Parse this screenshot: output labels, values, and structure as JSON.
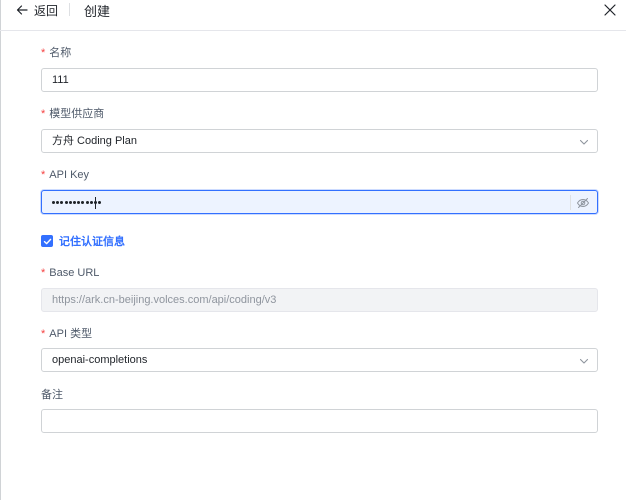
{
  "header": {
    "back_label": "返回",
    "title": "创建"
  },
  "form": {
    "name": {
      "label": "名称",
      "required": "*",
      "value": "111"
    },
    "provider": {
      "label": "模型供应商",
      "required": "*",
      "value": "方舟 Coding Plan"
    },
    "api_key": {
      "label": "API Key",
      "required": "*",
      "masked_length": 12
    },
    "remember": {
      "label": "记住认证信息",
      "checked": true
    },
    "base_url": {
      "label": "Base URL",
      "required": "*",
      "placeholder": "https://ark.cn-beijing.volces.com/api/coding/v3"
    },
    "api_type": {
      "label": "API 类型",
      "required": "*",
      "value": "openai-completions"
    },
    "notes": {
      "label": "备注",
      "value": ""
    }
  },
  "icons": {
    "back": "arrow-left-icon",
    "close": "close-icon",
    "select": "chevron-down-icon",
    "password_toggle": "eye-off-icon",
    "checkbox": "check-icon"
  },
  "colors": {
    "accent": "#3370ff",
    "required": "#f53f3f",
    "focused_bg": "#edf3ff"
  }
}
